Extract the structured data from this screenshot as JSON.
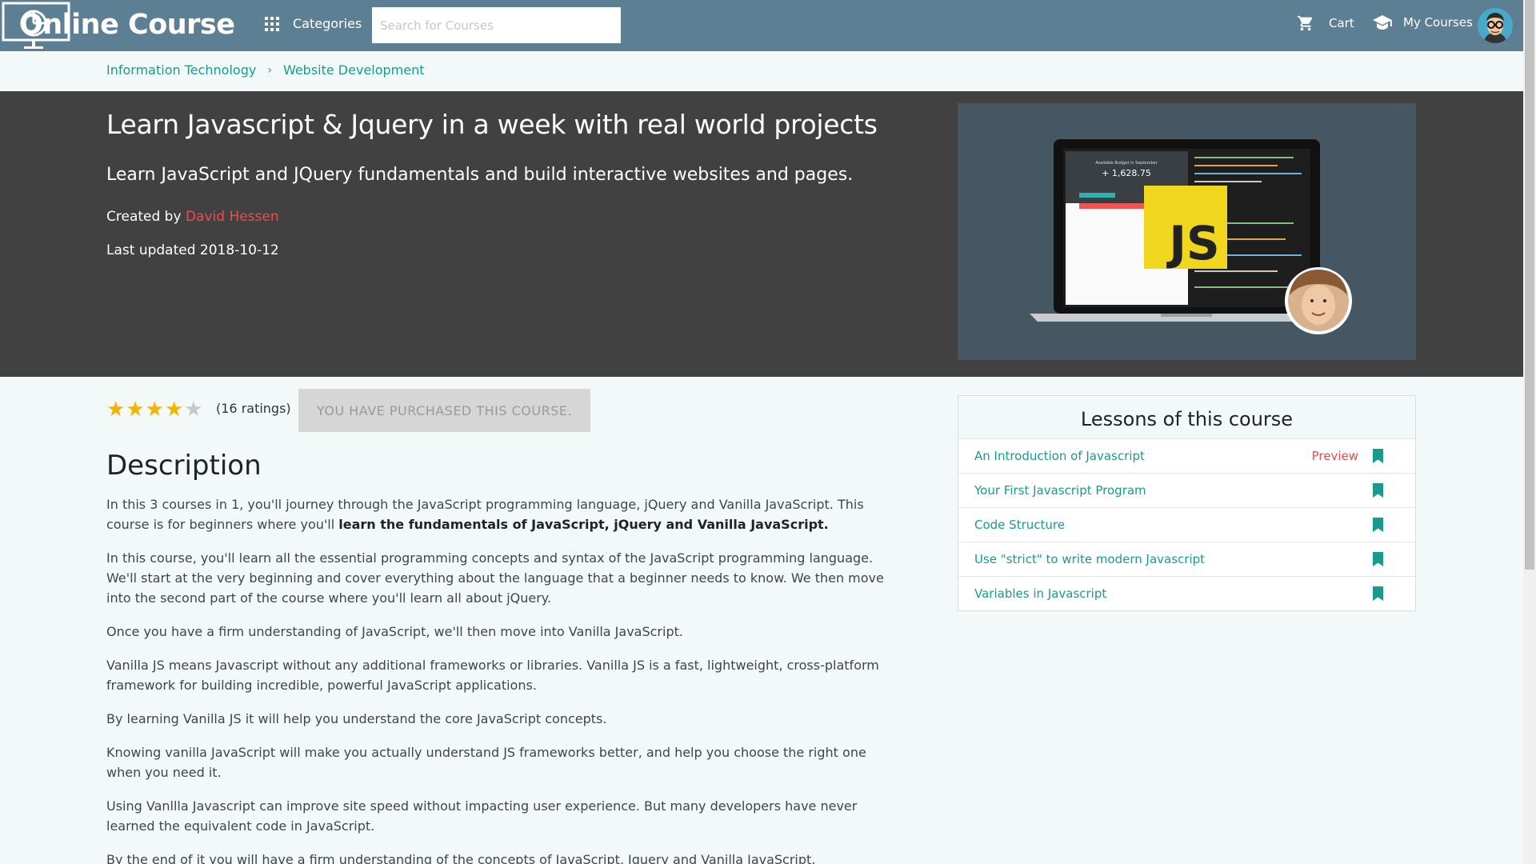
{
  "navbar": {
    "logo_text": "Online Course",
    "categories_label": "Categories",
    "search_placeholder": "Search for Courses",
    "cart_label": "Cart",
    "my_courses_label": "My Courses"
  },
  "breadcrumb": {
    "items": [
      "Information Technology",
      "Website Development"
    ],
    "separator": "›"
  },
  "course": {
    "title": "Learn Javascript & Jquery in a week with real world projects",
    "subtitle": "Learn JavaScript and JQuery fundamentals and build interactive websites and pages.",
    "created_by_label": "Created by",
    "author": "David Hessen",
    "last_updated_label": "Last updated",
    "last_updated": "2018-10-12",
    "thumbnail_text": {
      "js_badge": "JS",
      "budget_title": "Available Budget in September",
      "budget_value": "+ 1,628.75"
    },
    "rating": 4,
    "rating_max": 5,
    "ratings_count_text": "(16 ratings)",
    "purchased_label": "YOU HAVE PURCHASED THIS COURSE."
  },
  "description": {
    "title": "Description",
    "p1_a": "In this 3 courses in 1, you'll journey through the JavaScript programming language, jQuery and Vanilla JavaScript. This course is for beginners where you'll ",
    "p1_b": "learn the fundamentals of JavaScript, jQuery and Vanilla JavaScript.",
    "p2": "In this course, you'll learn all the essential programming concepts and syntax of the JavaScript programming language. We'll start at the very beginning and cover everything about the language that a beginner needs to know. We then move into the second part of the course where you'll learn all about jQuery.",
    "p3": "Once you have a firm understanding of JavaScript, we'll then move into Vanilla JavaScript.",
    "p4": "Vanilla JS means Javascript without any additional frameworks or libraries. Vanilla JS is a fast, lightweight, cross-platform framework for building incredible, powerful JavaScript applications.",
    "p5": "By learning Vanilla JS it will help you understand the core JavaScript concepts.",
    "p6": "Knowing vanilla JavaScript will make you actually understand JS frameworks better, and help you choose the right one when you need it.",
    "p7": "Using Vanllla Javascript can improve site speed without impacting user experience. But many developers have never learned the equivalent code in JavaScript.",
    "p8": "By the end of it you will have a firm understanding of the concepts of JavaScript, Jquery and Vanilla JavaScript."
  },
  "lessons": {
    "title": "Lessons of this course",
    "items": [
      {
        "name": "An Introduction of Javascript",
        "preview": "Preview"
      },
      {
        "name": "Your First Javascript Program",
        "preview": ""
      },
      {
        "name": "Code Structure",
        "preview": ""
      },
      {
        "name": "Use \"strict\" to write modern Javascript",
        "preview": ""
      },
      {
        "name": "Variables in Javascript",
        "preview": ""
      }
    ]
  },
  "colors": {
    "navbar": "#5d7f93",
    "hero": "#414141",
    "accent_teal": "#1a9a8e",
    "author_red": "#ef4b4b",
    "star": "#f5b301"
  },
  "icons": [
    "monitor-logo-icon",
    "grid-icon",
    "cart-icon",
    "graduation-cap-icon",
    "avatar",
    "bookmark-icon",
    "chevron-right-icon",
    "star-icon"
  ]
}
